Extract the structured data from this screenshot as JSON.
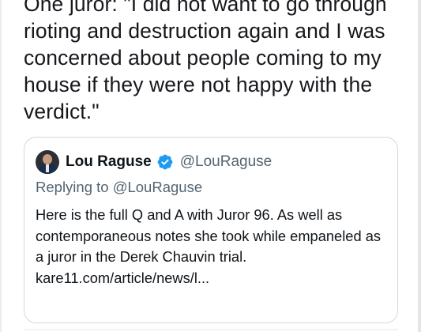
{
  "tweet": {
    "text": "One juror: \"I did not want to go through rioting and destruction again and I was concerned about people coming to my house if they were not happy with the verdict.\""
  },
  "quoted_tweet": {
    "display_name": "Lou Raguse",
    "handle": "@LouRaguse",
    "replying_prefix": "Replying to",
    "replying_to": "@LouRaguse",
    "body": "Here is the full Q and A with Juror 96. As well as contemporaneous notes she took while empaneled as a juror in the Derek Chauvin trial.",
    "link": "kare11.com/article/news/l...",
    "verified_icon": "verified-badge-icon",
    "verified_color": "#1d9bf0"
  }
}
